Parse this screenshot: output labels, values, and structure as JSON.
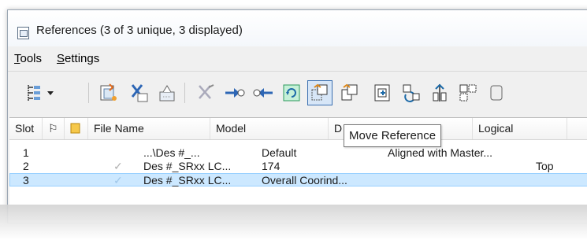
{
  "window": {
    "title": "References (3 of 3 unique, 3 displayed)"
  },
  "menu": {
    "items": [
      {
        "label_acc": "T",
        "label_rest": "ools"
      },
      {
        "label_acc": "S",
        "label_rest": "ettings"
      }
    ]
  },
  "toolbar": {
    "buttons": [
      {
        "name": "tree-view-icon"
      },
      {
        "name": "attach-reference-icon"
      },
      {
        "name": "detach-reference-icon"
      },
      {
        "name": "reload-reference-icon"
      },
      {
        "name": "exchange-reference-icon"
      },
      {
        "name": "hilite-reference-icon"
      },
      {
        "name": "rotate-reference-icon"
      },
      {
        "name": "refresh-reference-icon"
      },
      {
        "name": "move-reference-icon"
      },
      {
        "name": "copy-reference-icon"
      },
      {
        "name": "scale-reference-icon"
      },
      {
        "name": "rotate-view-icon"
      },
      {
        "name": "mirror-reference-icon"
      },
      {
        "name": "clip-boundary-icon"
      },
      {
        "name": "clip-mask-icon"
      }
    ],
    "active_index": 8,
    "accent_color": "#3a6fb0"
  },
  "table": {
    "headers": {
      "slot": "Slot",
      "flag": "⚐",
      "file_name": "File Name",
      "model": "Model",
      "description": "D",
      "logical": "Logical"
    },
    "rows": [
      {
        "slot": "1",
        "check": "",
        "file_name": "...\\Des #_...",
        "model": "Default",
        "description": "Aligned with Master...",
        "logical": ""
      },
      {
        "slot": "2",
        "check": "✓",
        "file_name": "Des #_SRxx LC...",
        "model": "174",
        "description": "",
        "logical": "Top"
      },
      {
        "slot": "3",
        "check": "✓",
        "file_name": "Des #_SRxx LC...",
        "model": "Overall Coorind...",
        "description": "",
        "logical": ""
      }
    ],
    "selected_row": 3
  },
  "tooltip": {
    "text": "Move Reference"
  }
}
